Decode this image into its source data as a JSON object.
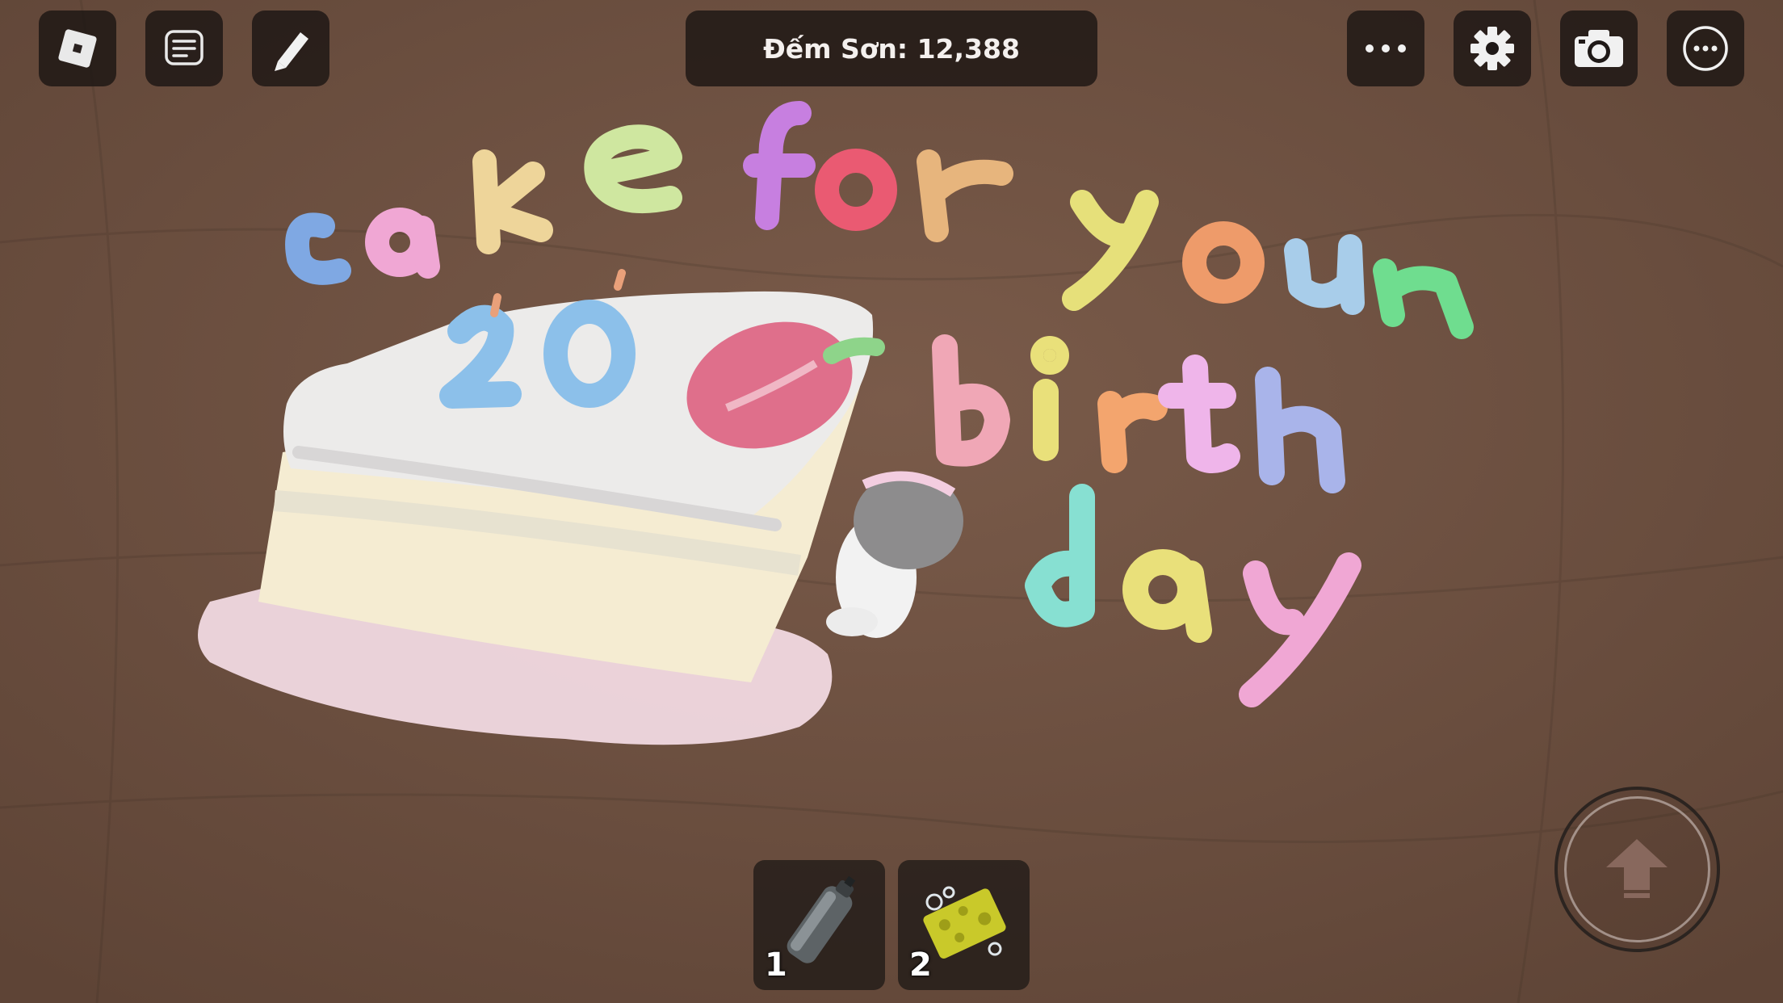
{
  "hud": {
    "paint_counter": "Đếm Sơn: 12,388"
  },
  "toolbar_left": [
    {
      "name": "roblox-menu-icon"
    },
    {
      "name": "chat-icon"
    },
    {
      "name": "pencil-icon"
    }
  ],
  "toolbar_right": [
    {
      "name": "more-dots-icon"
    },
    {
      "name": "gear-icon"
    },
    {
      "name": "camera-icon"
    },
    {
      "name": "more-circle-icon"
    }
  ],
  "hotbar": [
    {
      "slot": "1",
      "item": "spray-can-icon"
    },
    {
      "slot": "2",
      "item": "sponge-icon"
    }
  ],
  "drawing": {
    "words": [
      "cake",
      "for",
      "your",
      "birth",
      "day"
    ],
    "cake_number": "20"
  },
  "colors": {
    "ground": "#6e5142",
    "hud_bg": "#1c1614"
  }
}
